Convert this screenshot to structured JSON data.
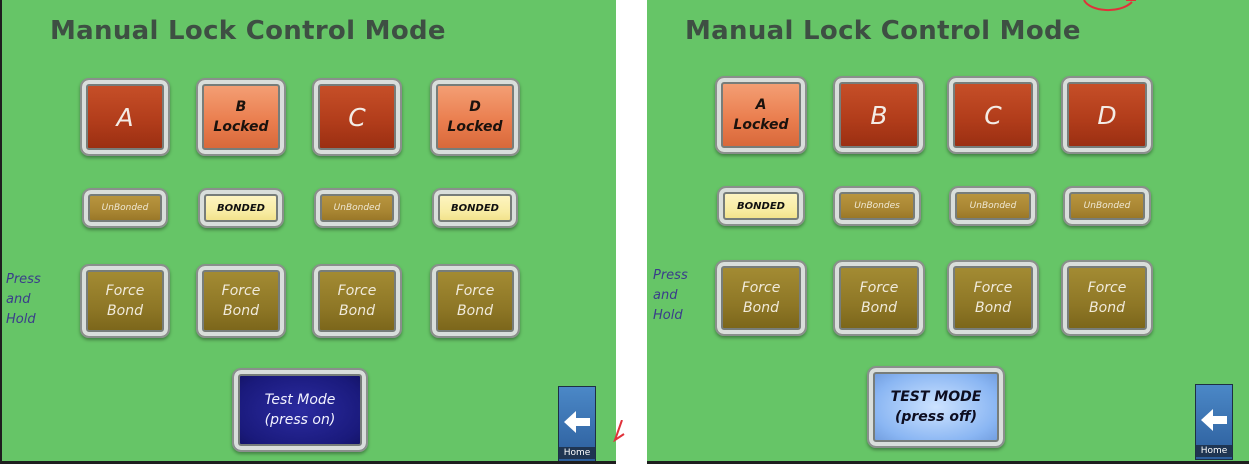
{
  "panels": [
    {
      "title": "Manual Lock Control Mode",
      "locks": [
        {
          "letter": "A",
          "status": "",
          "state": "unlocked"
        },
        {
          "letter": "B",
          "status": "Locked",
          "state": "locked"
        },
        {
          "letter": "C",
          "status": "",
          "state": "unlocked"
        },
        {
          "letter": "D",
          "status": "Locked",
          "state": "locked"
        }
      ],
      "bonds": [
        {
          "label": "UnBonded",
          "state": "unbonded"
        },
        {
          "label": "BONDED",
          "state": "bonded"
        },
        {
          "label": "UnBonded",
          "state": "unbonded"
        },
        {
          "label": "BONDED",
          "state": "bonded"
        }
      ],
      "press_hold": [
        "Press",
        "and",
        "Hold"
      ],
      "force_bond": [
        {
          "line1": "Force",
          "line2": "Bond"
        },
        {
          "line1": "Force",
          "line2": "Bond"
        },
        {
          "line1": "Force",
          "line2": "Bond"
        },
        {
          "line1": "Force",
          "line2": "Bond"
        }
      ],
      "test_mode": {
        "line1": "Test Mode",
        "line2": "(press on)",
        "state": "off"
      },
      "home": {
        "label": "Home",
        "icon": "back-arrow-icon"
      }
    },
    {
      "title": "Manual Lock Control Mode",
      "locks": [
        {
          "letter": "A",
          "status": "Locked",
          "state": "locked"
        },
        {
          "letter": "B",
          "status": "",
          "state": "unlocked"
        },
        {
          "letter": "C",
          "status": "",
          "state": "unlocked"
        },
        {
          "letter": "D",
          "status": "",
          "state": "unlocked"
        }
      ],
      "bonds": [
        {
          "label": "BONDED",
          "state": "bonded"
        },
        {
          "label": "UnBondes",
          "state": "unbonded"
        },
        {
          "label": "UnBonded",
          "state": "unbonded"
        },
        {
          "label": "UnBonded",
          "state": "unbonded"
        }
      ],
      "press_hold": [
        "Press",
        "and",
        "Hold"
      ],
      "force_bond": [
        {
          "line1": "Force",
          "line2": "Bond"
        },
        {
          "line1": "Force",
          "line2": "Bond"
        },
        {
          "line1": "Force",
          "line2": "Bond"
        },
        {
          "line1": "Force",
          "line2": "Bond"
        }
      ],
      "test_mode": {
        "line1": "TEST MODE",
        "line2": "(press off)",
        "state": "on"
      },
      "home": {
        "label": "Home",
        "icon": "back-arrow-icon"
      }
    }
  ],
  "colors": {
    "background": "#66c567",
    "lock_unlocked": "#b23d1b",
    "lock_locked": "#ea7e4f",
    "bond_unbonded": "#a88532",
    "bond_bonded": "#f8eca3",
    "force_bond": "#8e7726",
    "test_off": "#1a1a7c",
    "test_on": "#8ab6f3",
    "home": "#2c5e9c"
  }
}
